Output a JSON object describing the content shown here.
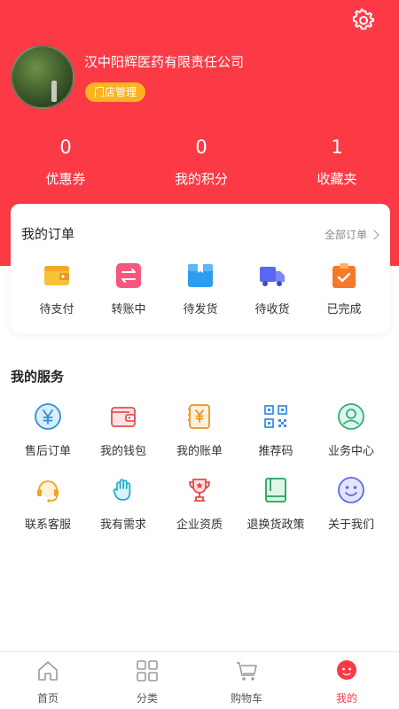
{
  "profile": {
    "company_name": "汉中阳辉医药有限责任公司",
    "store_badge": "门店管理"
  },
  "stats": [
    {
      "value": "0",
      "label": "优惠券"
    },
    {
      "value": "0",
      "label": "我的积分"
    },
    {
      "value": "1",
      "label": "收藏夹"
    }
  ],
  "orders": {
    "title": "我的订单",
    "all_label": "全部订单",
    "items": [
      {
        "label": "待支付",
        "icon": "wallet-icon"
      },
      {
        "label": "转账中",
        "icon": "transfer-icon"
      },
      {
        "label": "待发货",
        "icon": "package-icon"
      },
      {
        "label": "待收货",
        "icon": "truck-icon"
      },
      {
        "label": "已完成",
        "icon": "clipboard-check-icon"
      }
    ]
  },
  "services": {
    "title": "我的服务",
    "items": [
      {
        "label": "售后订单",
        "icon": "yen-circle-icon"
      },
      {
        "label": "我的钱包",
        "icon": "wallet-icon"
      },
      {
        "label": "我的账单",
        "icon": "bill-icon"
      },
      {
        "label": "推荐码",
        "icon": "qr-code-icon"
      },
      {
        "label": "业务中心",
        "icon": "user-circle-icon"
      },
      {
        "label": "联系客服",
        "icon": "headset-icon"
      },
      {
        "label": "我有需求",
        "icon": "hand-icon"
      },
      {
        "label": "企业资质",
        "icon": "trophy-icon"
      },
      {
        "label": "退换货政策",
        "icon": "book-icon"
      },
      {
        "label": "关于我们",
        "icon": "smile-icon"
      }
    ]
  },
  "tabbar": {
    "items": [
      {
        "label": "首页",
        "icon": "home-icon"
      },
      {
        "label": "分类",
        "icon": "grid-icon"
      },
      {
        "label": "购物车",
        "icon": "cart-icon"
      },
      {
        "label": "我的",
        "icon": "profile-icon"
      }
    ],
    "active_index": 3
  },
  "colors": {
    "brand_red": "#fb3a46",
    "badge_yellow": "#fcb320"
  }
}
